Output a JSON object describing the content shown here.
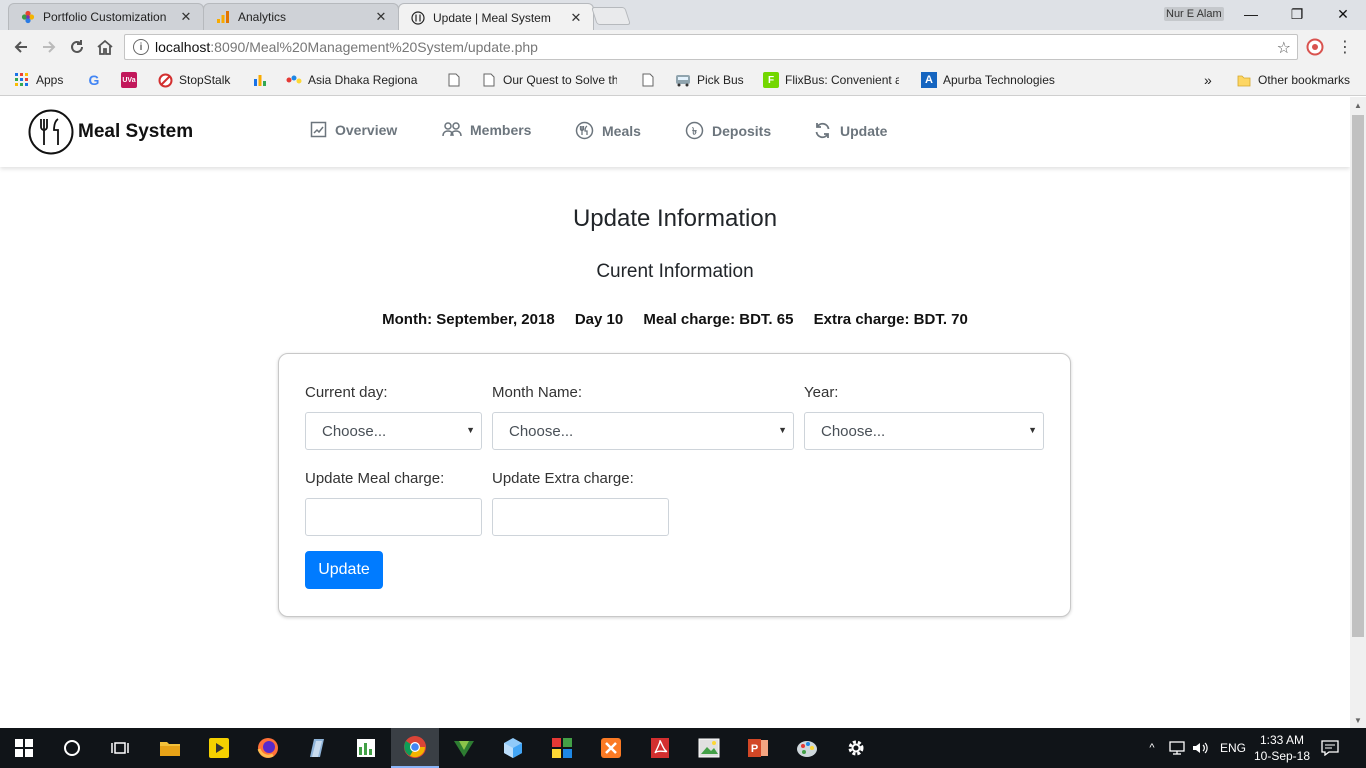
{
  "browser": {
    "tabs": [
      {
        "title": "Portfolio Customization",
        "icon": "flower-icon",
        "active": false
      },
      {
        "title": "Analytics",
        "icon": "analytics-icon",
        "active": false
      },
      {
        "title": "Update | Meal System",
        "icon": "meal-logo-icon",
        "active": true
      }
    ],
    "window_user": "Nur E Alam",
    "url_host": "localhost",
    "url_path": ":8090/Meal%20Management%20System/update.php"
  },
  "bookmarks": {
    "items": [
      {
        "label": "Apps",
        "icon": "apps-grid-icon"
      },
      {
        "label": "",
        "icon": "google-icon"
      },
      {
        "label": "",
        "icon": "uva-icon"
      },
      {
        "label": "StopStalk",
        "icon": "stopstalk-icon"
      },
      {
        "label": "",
        "icon": "bar-chart-icon"
      },
      {
        "label": "Asia Dhaka Regional",
        "icon": "asia-icon"
      },
      {
        "label": "",
        "icon": "page-icon"
      },
      {
        "label": "Our Quest to Solve th",
        "icon": "page-icon"
      },
      {
        "label": "",
        "icon": "page-icon"
      },
      {
        "label": "Pick Bus",
        "icon": "bus-icon"
      },
      {
        "label": "FlixBus: Convenient a",
        "icon": "flixbus-icon"
      },
      {
        "label": "Apurba Technologies",
        "icon": "apurba-icon"
      }
    ],
    "overflow": "»",
    "other": "Other bookmarks"
  },
  "nav": {
    "brand": "Meal System",
    "links": [
      {
        "label": "Overview",
        "icon": "chart-icon"
      },
      {
        "label": "Members",
        "icon": "members-icon"
      },
      {
        "label": "Meals",
        "icon": "meal-icon"
      },
      {
        "label": "Deposits",
        "icon": "taka-icon"
      },
      {
        "label": "Update",
        "icon": "refresh-icon"
      }
    ]
  },
  "page": {
    "title": "Update Information",
    "subtitle": "Curent Information",
    "month": "Month: September, 2018",
    "day": "Day 10",
    "meal_charge": "Meal charge: BDT. 65",
    "extra_charge": "Extra charge: BDT. 70"
  },
  "form": {
    "day_label": "Current day:",
    "month_label": "Month Name:",
    "year_label": "Year:",
    "day_value": "Choose...",
    "month_value": "Choose...",
    "year_value": "Choose...",
    "meal_charge_label": "Update Meal charge:",
    "extra_charge_label": "Update Extra charge:",
    "meal_charge_value": "",
    "extra_charge_value": "",
    "submit": "Update"
  },
  "taskbar": {
    "lang": "ENG",
    "time": "1:33 AM",
    "date": "10-Sep-18"
  },
  "colors": {
    "primary": "#007bff",
    "nav_text": "#6c757d",
    "taskbar": "#101418"
  }
}
